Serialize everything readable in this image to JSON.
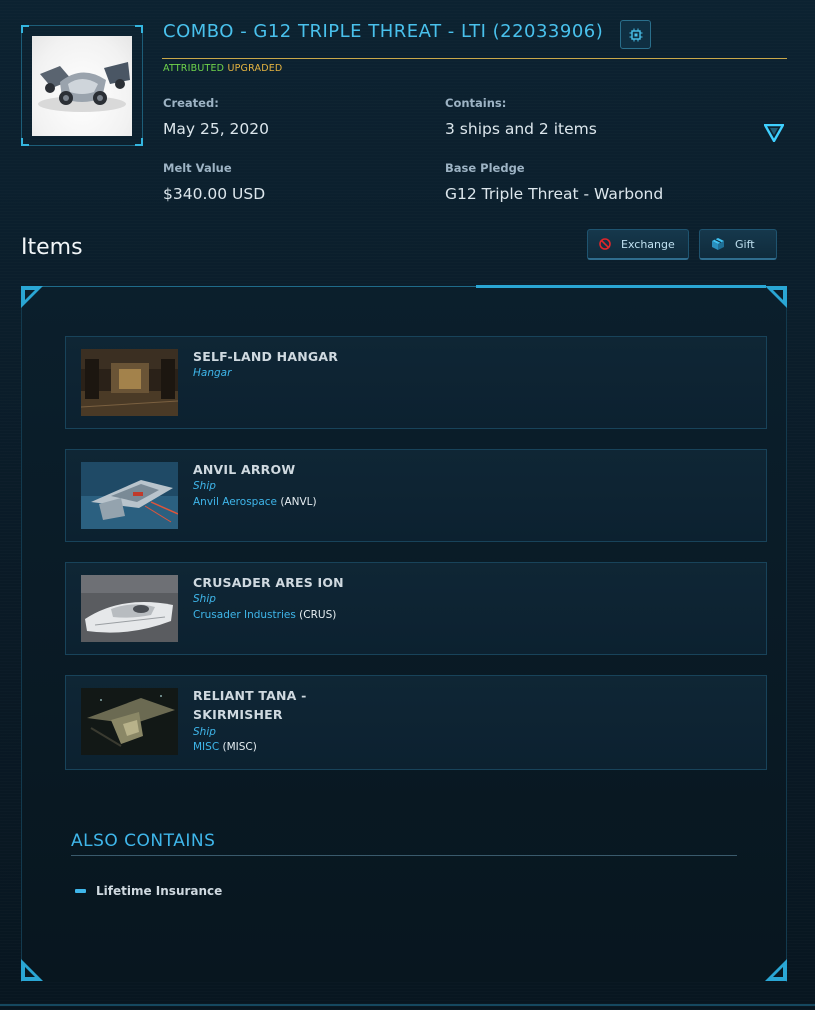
{
  "pledge": {
    "title": "COMBO - G12 TRIPLE THREAT - LTI (22033906)",
    "badges": {
      "attributed": "ATTRIBUTED",
      "upgraded": "UPGRADED"
    },
    "created_label": "Created:",
    "created_value": "May 25, 2020",
    "contains_label": "Contains:",
    "contains_value": "3 ships and 2 items",
    "melt_label": "Melt Value",
    "melt_value": "$340.00 USD",
    "base_label": "Base Pledge",
    "base_value": "G12 Triple Threat - Warbond"
  },
  "items_section": {
    "heading": "Items",
    "exchange_label": "Exchange",
    "gift_label": "Gift"
  },
  "items": [
    {
      "name": "SELF-LAND HANGAR",
      "type": "Hangar"
    },
    {
      "name": "ANVIL ARROW",
      "type": "Ship",
      "maker": "Anvil Aerospace",
      "maker_code": "(ANVL)"
    },
    {
      "name": "CRUSADER ARES ION",
      "type": "Ship",
      "maker": "Crusader Industries",
      "maker_code": "(CRUS)"
    },
    {
      "name_line1": "RELIANT TANA -",
      "name_line2": "SKIRMISHER",
      "type": "Ship",
      "maker": "MISC",
      "maker_code": "(MISC)"
    }
  ],
  "also_contains": {
    "title": "ALSO CONTAINS",
    "entries": [
      "Lifetime Insurance"
    ]
  },
  "icons": {
    "chip": "chip-icon",
    "toggle": "triangle-down-icon",
    "exchange": "no-entry-icon",
    "gift": "gift-box-icon"
  },
  "colors": {
    "accent": "#3fb6ea",
    "attributed": "#6fd44b",
    "upgraded": "#e4b340",
    "title_rule": "#c9a84a"
  }
}
